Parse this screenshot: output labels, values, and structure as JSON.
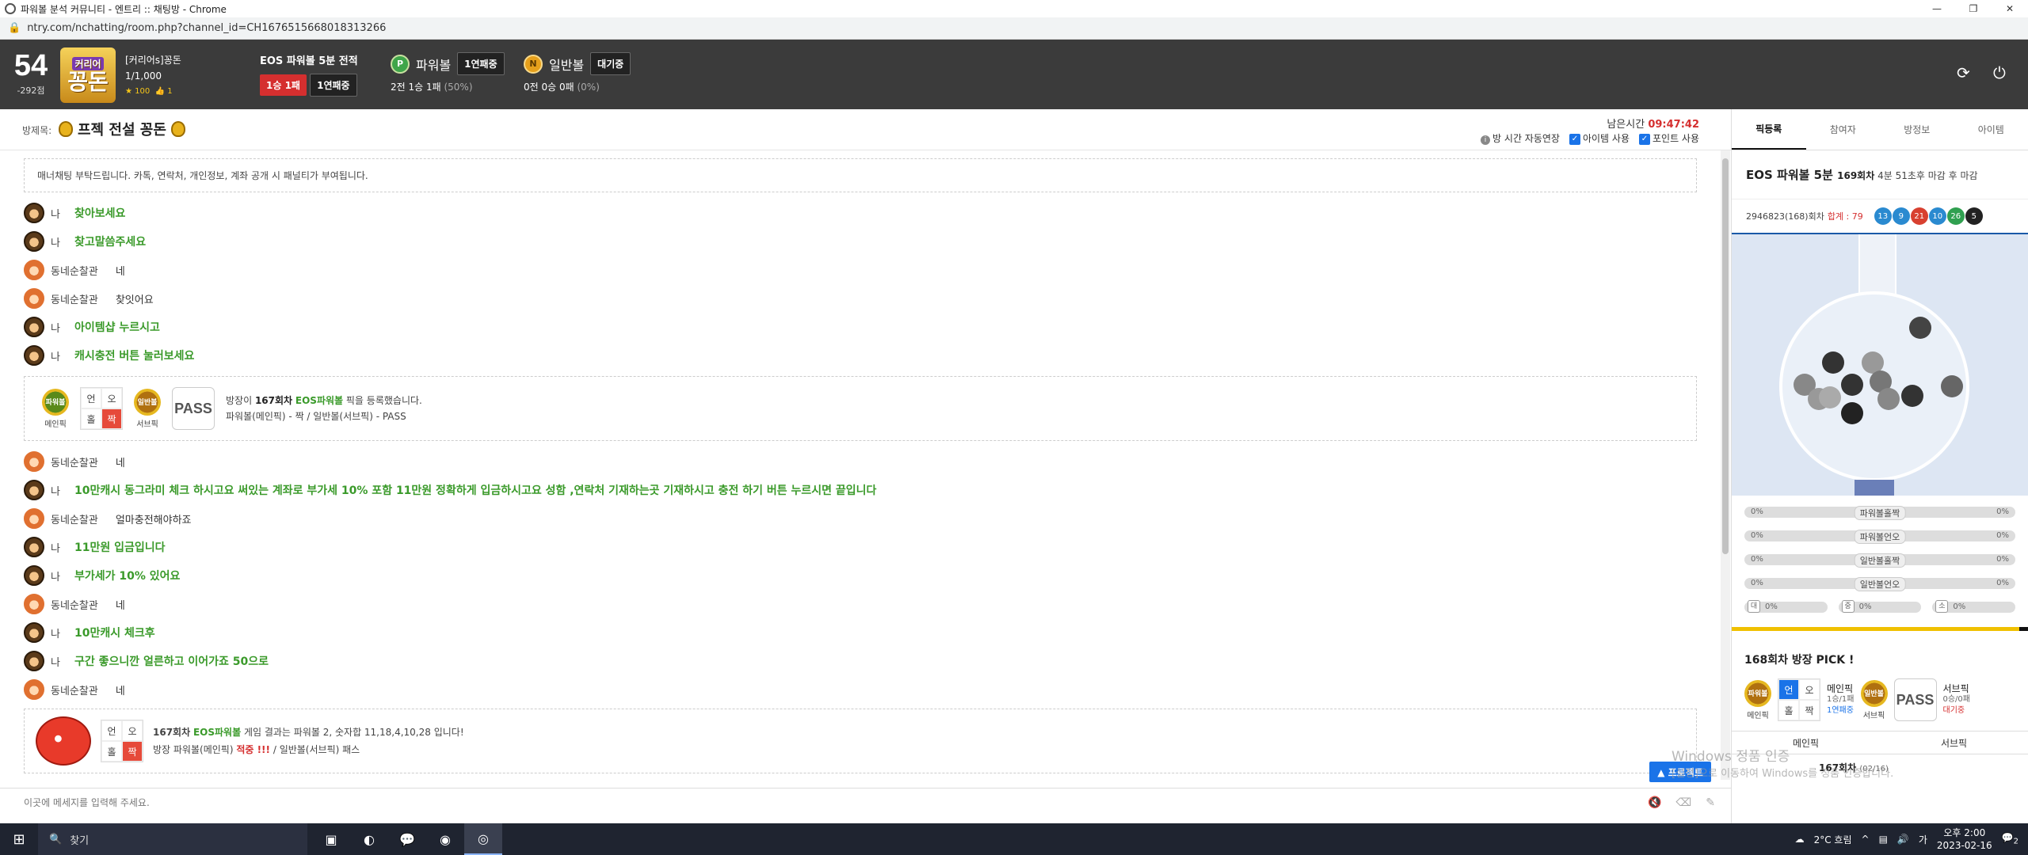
{
  "window": {
    "title": "파워볼 분석 커뮤니티 - 엔트리 :: 채팅방 - Chrome",
    "controls": [
      "—",
      "❐",
      "✕"
    ]
  },
  "address_bar": {
    "url": "ntry.com/nchatting/room.php?channel_id=CH1676515668018313266"
  },
  "header": {
    "level": "54",
    "points": "-292점",
    "logo_top": "커리어",
    "logo_main": "꽁돈",
    "user_name": "[커리어s]꽁돈",
    "user_count": "1/1,000",
    "stars": "★ 100",
    "likes": "👍 1",
    "eos_title": "EOS 파워볼 5분 전적",
    "eos_record": "1승 1패",
    "eos_streak": "1연패중",
    "powerball": {
      "coin": "P",
      "label": "파워볼",
      "badge": "1연패중",
      "record": "2전 1승 1패",
      "rate": "(50%)"
    },
    "normalball": {
      "coin": "N",
      "label": "일반볼",
      "badge": "대기중",
      "record": "0전 0승 0패",
      "rate": "(0%)"
    }
  },
  "room": {
    "label": "방제목:",
    "name": "프젝 전설 꽁돈",
    "remain_label": "남은시간",
    "remain_time": "09:47:42",
    "opt_auto": "방 시간 자동연장",
    "opt_item": "아이템 사용",
    "opt_point": "포인트 사용"
  },
  "chat": {
    "notice": "매너채팅 부탁드립니다. 카톡, 연락처, 개인정보, 계좌 공개 시 패널티가 부여됩니다.",
    "msgs_a": [
      {
        "name": "나",
        "text": "찾아보세요",
        "me": true
      },
      {
        "name": "나",
        "text": "찾고말씀주세요",
        "me": true
      },
      {
        "name": "동네순찰관",
        "text": "네",
        "me": false
      },
      {
        "name": "동네순찰관",
        "text": "찾잇어요",
        "me": false
      },
      {
        "name": "나",
        "text": "아이템샵 누르시고",
        "me": true
      },
      {
        "name": "나",
        "text": "캐시충전 버튼 눌러보세요",
        "me": true
      }
    ],
    "pick": {
      "main_ball": "파워볼",
      "main_label": "메인픽",
      "g1": "언",
      "g2": "오",
      "g3": "홀",
      "g4": "짝",
      "sub_ball": "일반볼",
      "sub_label": "서브픽",
      "pass": "PASS",
      "line1_a": "방장이 ",
      "line1_round": "167회차",
      "line1_game": "EOS파워볼",
      "line1_b": " 픽을 등록했습니다.",
      "line2": "파워볼(메인픽) - 짝 / 일반볼(서브픽) - PASS"
    },
    "msgs_b": [
      {
        "name": "동네순찰관",
        "text": "네",
        "me": false
      },
      {
        "name": "나",
        "text": "10만캐시 동그라미 체크 하시고요 써있는 계좌로 부가세 10% 포함 11만원 정확하게 입금하시고요 성함 ,연락처 기재하는곳 기재하시고 충전 하기 버튼 누르시면 끝입니다",
        "me": true
      },
      {
        "name": "동네순찰관",
        "text": "얼마충전해야하죠",
        "me": false
      },
      {
        "name": "나",
        "text": "11만원 입금입니다",
        "me": true
      },
      {
        "name": "나",
        "text": "부가세가 10% 있어요",
        "me": true
      },
      {
        "name": "동네순찰관",
        "text": "네",
        "me": false
      },
      {
        "name": "나",
        "text": "10만캐시 체크후",
        "me": true
      },
      {
        "name": "나",
        "text": "구간 좋으니깐 얼른하고 이어가죠 50으로",
        "me": true
      },
      {
        "name": "동네순찰관",
        "text": "네",
        "me": false
      }
    ],
    "result": {
      "g1": "언",
      "g2": "오",
      "g3": "홀",
      "g4": "짝",
      "round": "167회차",
      "game": "EOS파워볼",
      "line1": " 게임 결과는 파워볼 2, 숫자합 11,18,4,10,28 입니다!",
      "line2_a": "방장 파워볼(메인픽) ",
      "line2_hit": "적중 !!!",
      "line2_b": " / 일반볼(서브픽) 패스"
    },
    "input_placeholder": "이곳에 메세지를 입력해 주세요.",
    "promo_button": "▲ 프로젝트"
  },
  "right": {
    "tabs": [
      "픽등록",
      "참여자",
      "방정보",
      "아이템"
    ],
    "game_title": "EOS 파워볼 5분",
    "round_info_a": "169회차",
    "round_info_b": " 4분 51초후 마감 후 마감",
    "draw_id": "2946823(168)회차",
    "sum_label": "합계 : 79",
    "balls": [
      {
        "n": "13",
        "c": "#2a8ad0"
      },
      {
        "n": "9",
        "c": "#2a8ad0"
      },
      {
        "n": "21",
        "c": "#d84030"
      },
      {
        "n": "10",
        "c": "#2a8ad0"
      },
      {
        "n": "26",
        "c": "#30a050"
      },
      {
        "n": "5",
        "c": "#222222"
      }
    ],
    "rates": [
      {
        "l": "0%",
        "c": "파워볼홀짝",
        "r": "0%"
      },
      {
        "l": "0%",
        "c": "파워볼언오",
        "r": "0%"
      },
      {
        "l": "0%",
        "c": "일반볼홀짝",
        "r": "0%"
      },
      {
        "l": "0%",
        "c": "일반볼언오",
        "r": "0%"
      }
    ],
    "mini": [
      {
        "ic": "대",
        "pc": "0%"
      },
      {
        "ic": "중",
        "pc": "0%"
      },
      {
        "ic": "소",
        "pc": "0%"
      }
    ],
    "pick_head": "168회차 방장 PICK !",
    "main_ball": "파워볼",
    "main_sub": "메인픽",
    "g1": "언",
    "g2": "오",
    "g3": "홀",
    "g4": "짝",
    "main_lbl": "메인픽",
    "main_rec": "1승/1패",
    "main_streak": "1연패중",
    "sub_ball": "일반볼",
    "sub_sub": "서브픽",
    "pass": "PASS",
    "sub_lbl": "서브픽",
    "sub_rec": "0승/0패",
    "sub_wait": "대기중",
    "tabs2": [
      "메인픽",
      "서브픽"
    ],
    "round2": "167회차",
    "round2_sub": "(02/16)"
  },
  "watermark": {
    "line1": "Windows 정품 인증",
    "line2": "[설정]으로 이동하여 Windows를 정품 인증합니다."
  },
  "taskbar": {
    "search": "찾기",
    "weather": "2°C 흐림",
    "time": "오후 2:00",
    "date": "2023-02-16",
    "notif": "2"
  }
}
